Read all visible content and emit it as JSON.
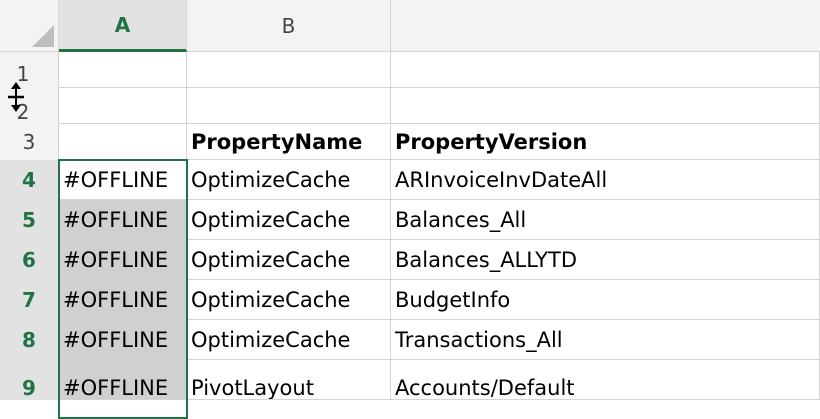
{
  "columns": [
    "A",
    "B",
    ""
  ],
  "rows": [
    {
      "num": "1",
      "a": "",
      "b": "",
      "c": ""
    },
    {
      "num": "2",
      "a": "",
      "b": "",
      "c": ""
    },
    {
      "num": "3",
      "a": "",
      "b": "PropertyName",
      "c": "PropertyVersion"
    },
    {
      "num": "4",
      "a": "#OFFLINE",
      "b": "OptimizeCache",
      "c": "ARInvoiceInvDateAll"
    },
    {
      "num": "5",
      "a": "#OFFLINE",
      "b": "OptimizeCache",
      "c": "Balances_All"
    },
    {
      "num": "6",
      "a": "#OFFLINE",
      "b": "OptimizeCache",
      "c": "Balances_ALLYTD"
    },
    {
      "num": "7",
      "a": "#OFFLINE",
      "b": "OptimizeCache",
      "c": "BudgetInfo"
    },
    {
      "num": "8",
      "a": "#OFFLINE",
      "b": "OptimizeCache",
      "c": "Transactions_All"
    },
    {
      "num": "9",
      "a": "#OFFLINE",
      "b": "PivotLayout",
      "c": "Accounts/Default"
    }
  ],
  "colors": {
    "accent": "#217346",
    "selection_fill": "#d0d0d0",
    "header_bg": "#f3f3f3"
  },
  "cursor_icon": "row-resize-icon"
}
